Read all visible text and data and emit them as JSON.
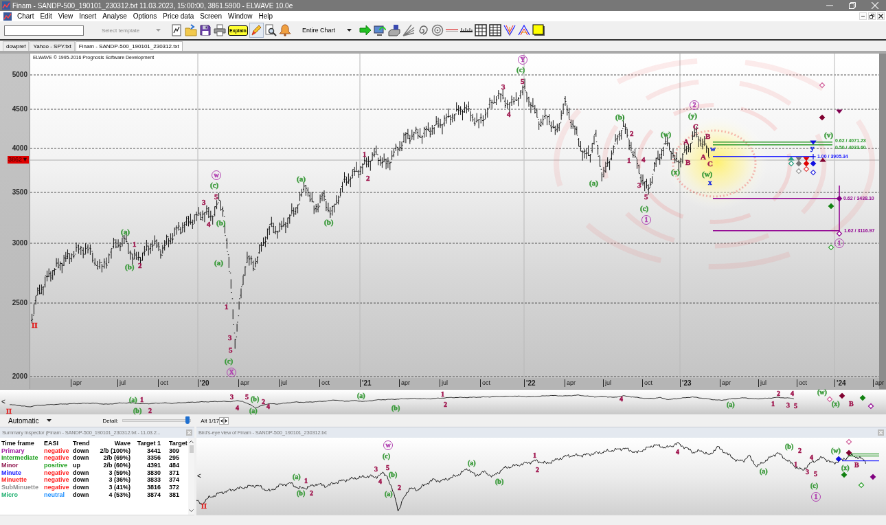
{
  "window": {
    "title": "Finam - SANDP-500_190101_230312.txt  11.03.2023, 15:00:00, 3861.5900 - ELWAVE 10.0e"
  },
  "menu": [
    "Chart",
    "Edit",
    "View",
    "Insert",
    "Analyse",
    "Options",
    "Price data",
    "Screen",
    "Window",
    "Help"
  ],
  "toolbar": {
    "template": {
      "placeholder": "Select template",
      "disabled": true
    },
    "tools_left": [
      {
        "kind": "chart",
        "selected": false
      },
      {
        "kind": "open",
        "selected": false
      },
      {
        "kind": "save",
        "selected": false
      },
      {
        "kind": "print",
        "selected": false
      },
      {
        "kind": "explain",
        "label": "Explain",
        "selected": false
      },
      {
        "kind": "draw",
        "selected": true
      },
      {
        "kind": "inspect",
        "selected": false
      },
      {
        "kind": "alert",
        "selected": false
      }
    ],
    "range": "Entire Chart",
    "tools_right": [
      {
        "kind": "go",
        "selected": false
      },
      {
        "kind": "monitor",
        "selected": false
      },
      {
        "kind": "drive",
        "selected": false
      },
      {
        "kind": "fan",
        "selected": false
      },
      {
        "kind": "spiral",
        "selected": false
      },
      {
        "kind": "circles",
        "selected": false
      },
      {
        "kind": "line",
        "selected": false
      },
      {
        "kind": "ruler",
        "selected": false
      },
      {
        "kind": "grid",
        "selected": false
      },
      {
        "kind": "table",
        "selected": false
      },
      {
        "kind": "vee",
        "selected": false
      },
      {
        "kind": "wedge",
        "selected": false
      },
      {
        "kind": "highlight",
        "selected": false
      }
    ]
  },
  "tabs": [
    {
      "label": "dowpref",
      "selected": false
    },
    {
      "label": "Yahoo - SPY.txt",
      "selected": false
    },
    {
      "label": "Finam - SANDP-500_190101_230312.txt",
      "selected": true
    }
  ],
  "chart": {
    "copyright": "ELWAVE © 1995-2016 Prognosis Software Development",
    "price_labels": [
      "5000",
      "4500",
      "4000",
      "3500",
      "3000",
      "2500",
      "2000"
    ],
    "current_price": "3862▼",
    "time_labels": [
      {
        "text": "apr",
        "kind": "month"
      },
      {
        "text": "jul",
        "kind": "month"
      },
      {
        "text": "oct",
        "kind": "month"
      },
      {
        "text": "'20",
        "kind": "year"
      },
      {
        "text": "apr",
        "kind": "month"
      },
      {
        "text": "jul",
        "kind": "month"
      },
      {
        "text": "oct",
        "kind": "month"
      },
      {
        "text": "'21",
        "kind": "year"
      },
      {
        "text": "apr",
        "kind": "month"
      },
      {
        "text": "jul",
        "kind": "month"
      },
      {
        "text": "oct",
        "kind": "month"
      },
      {
        "text": "'22",
        "kind": "year"
      },
      {
        "text": "apr",
        "kind": "month"
      },
      {
        "text": "jul",
        "kind": "month"
      },
      {
        "text": "oct",
        "kind": "month"
      },
      {
        "text": "'23",
        "kind": "year"
      },
      {
        "text": "apr",
        "kind": "month"
      },
      {
        "text": "jul",
        "kind": "month"
      },
      {
        "text": "oct",
        "kind": "month"
      },
      {
        "text": "'24",
        "kind": "year"
      },
      {
        "text": "apr",
        "kind": "month"
      }
    ],
    "wave_labels": [
      {
        "text": "II",
        "color": "#e02020",
        "kind": "plain"
      },
      {
        "text": "(a)",
        "color": "#3a9a3a",
        "kind": "plain"
      },
      {
        "text": "1",
        "color": "#a01850",
        "kind": "plain"
      },
      {
        "text": "(b)",
        "color": "#3a9a3a",
        "kind": "plain"
      },
      {
        "text": "2",
        "color": "#a01850",
        "kind": "plain"
      },
      {
        "text": "3",
        "color": "#a01850",
        "kind": "plain"
      },
      {
        "text": "4",
        "color": "#a01850",
        "kind": "plain"
      },
      {
        "text": "w",
        "color": "#b040b0",
        "kind": "circled"
      },
      {
        "text": "(c)",
        "color": "#3a9a3a",
        "kind": "plain"
      },
      {
        "text": "5",
        "color": "#a01850",
        "kind": "plain"
      },
      {
        "text": "(b)",
        "color": "#3a9a3a",
        "kind": "plain"
      },
      {
        "text": "(a)",
        "color": "#3a9a3a",
        "kind": "plain"
      },
      {
        "text": "1",
        "color": "#a01850",
        "kind": "plain"
      },
      {
        "text": "3",
        "color": "#a01850",
        "kind": "plain"
      },
      {
        "text": "5",
        "color": "#a01850",
        "kind": "plain"
      },
      {
        "text": "(c)",
        "color": "#3a9a3a",
        "kind": "plain"
      },
      {
        "text": "X",
        "color": "#b040b0",
        "kind": "circled"
      },
      {
        "text": "(a)",
        "color": "#3a9a3a",
        "kind": "plain"
      },
      {
        "text": "(b)",
        "color": "#3a9a3a",
        "kind": "plain"
      },
      {
        "text": "1",
        "color": "#a01850",
        "kind": "plain"
      },
      {
        "text": "2",
        "color": "#a01850",
        "kind": "plain"
      },
      {
        "text": "3",
        "color": "#a01850",
        "kind": "plain"
      },
      {
        "text": "4",
        "color": "#a01850",
        "kind": "plain"
      },
      {
        "text": "Y",
        "color": "#b040b0",
        "kind": "circled"
      },
      {
        "text": "(c)",
        "color": "#3a9a3a",
        "kind": "plain"
      },
      {
        "text": "5",
        "color": "#a01850",
        "kind": "plain"
      },
      {
        "text": "(a)",
        "color": "#3a9a3a",
        "kind": "plain"
      },
      {
        "text": "(b)",
        "color": "#3a9a3a",
        "kind": "plain"
      },
      {
        "text": "2",
        "color": "#a01850",
        "kind": "plain"
      },
      {
        "text": "1",
        "color": "#a01850",
        "kind": "plain"
      },
      {
        "text": "3",
        "color": "#a01850",
        "kind": "plain"
      },
      {
        "text": "4",
        "color": "#a01850",
        "kind": "plain"
      },
      {
        "text": "5",
        "color": "#a01850",
        "kind": "plain"
      },
      {
        "text": "(c)",
        "color": "#3a9a3a",
        "kind": "plain"
      },
      {
        "text": "1",
        "color": "#b040b0",
        "kind": "circled"
      },
      {
        "text": "(w)",
        "color": "#3a9a3a",
        "kind": "plain"
      },
      {
        "text": "(x)",
        "color": "#3a9a3a",
        "kind": "plain"
      },
      {
        "text": "A",
        "color": "#a01850",
        "kind": "plain"
      },
      {
        "text": "B",
        "color": "#a01850",
        "kind": "plain"
      },
      {
        "text": "2",
        "color": "#b040b0",
        "kind": "circled"
      },
      {
        "text": "(y)",
        "color": "#3a9a3a",
        "kind": "plain"
      },
      {
        "text": "C",
        "color": "#a01850",
        "kind": "plain"
      },
      {
        "text": "B",
        "color": "#a01850",
        "kind": "plain"
      },
      {
        "text": "w",
        "color": "#2030e0",
        "kind": "plain"
      },
      {
        "text": "A",
        "color": "#a01850",
        "kind": "plain"
      },
      {
        "text": "C",
        "color": "#a01850",
        "kind": "plain"
      },
      {
        "text": "(w)",
        "color": "#3a9a3a",
        "kind": "plain"
      },
      {
        "text": "x",
        "color": "#2030e0",
        "kind": "plain"
      },
      {
        "text": "y",
        "color": "#2030e0",
        "kind": "plain"
      },
      {
        "text": "(v)",
        "color": "#3a9a3a",
        "kind": "plain"
      },
      {
        "text": "1",
        "color": "#b040b0",
        "kind": "circled"
      }
    ],
    "target_levels": [
      {
        "label": "0.62 / 4071.23",
        "color": "#2a9a2a"
      },
      {
        "label": "0.50 / 4033.60",
        "color": "#2a9a2a"
      },
      {
        "label": "1.00 / 3905.34",
        "color": "#2020ff"
      },
      {
        "label": "0.62 / 3438.10",
        "color": "#900090"
      },
      {
        "label": "1.62 / 3116.97",
        "color": "#900090"
      }
    ]
  },
  "overview": {
    "scroll_left": "<",
    "wave_labels": [
      {
        "text": "(a)",
        "color": "#3a9a3a"
      },
      {
        "text": "1",
        "color": "#a01850"
      },
      {
        "text": "(b)",
        "color": "#3a9a3a"
      },
      {
        "text": "2",
        "color": "#a01850"
      },
      {
        "text": "3",
        "color": "#a01850"
      },
      {
        "text": "4",
        "color": "#a01850"
      },
      {
        "text": "5",
        "color": "#a01850"
      },
      {
        "text": "(b)",
        "color": "#3a9a3a"
      },
      {
        "text": "2",
        "color": "#a01850"
      },
      {
        "text": "4",
        "color": "#a01850"
      },
      {
        "text": "(a)",
        "color": "#3a9a3a"
      },
      {
        "text": "(a)",
        "color": "#3a9a3a"
      },
      {
        "text": "(b)",
        "color": "#3a9a3a"
      },
      {
        "text": "1",
        "color": "#a01850"
      },
      {
        "text": "2",
        "color": "#a01850"
      },
      {
        "text": "4",
        "color": "#a01850"
      },
      {
        "text": "(a)",
        "color": "#3a9a3a"
      },
      {
        "text": "2",
        "color": "#a01850"
      },
      {
        "text": "1",
        "color": "#a01850"
      },
      {
        "text": "3",
        "color": "#a01850"
      },
      {
        "text": "4",
        "color": "#a01850"
      },
      {
        "text": "5",
        "color": "#a01850"
      },
      {
        "text": "(w)",
        "color": "#3a9a3a"
      },
      {
        "text": "(x)",
        "color": "#3a9a3a"
      },
      {
        "text": "B",
        "color": "#a01850"
      },
      {
        "text": "II",
        "color": "#e02020"
      }
    ]
  },
  "controls": {
    "mode": "Automatic",
    "detail_label": "Detail:",
    "detail": {
      "level": 0.96
    },
    "alternative": "Alt 1/17"
  },
  "summary": {
    "title": "Summary Inspector (Finam - SANDP-500_190101_230312.txt - 11.03.2...",
    "columns": [
      "Time frame",
      "EASI",
      "Trend",
      "Wave",
      "Target 1",
      "Target"
    ],
    "rows": [
      {
        "time_frame": {
          "text": "Primary",
          "color": "#a020a0"
        },
        "easi": {
          "text": "negative",
          "color": "#ff2020"
        },
        "trend": "down",
        "wave": "2/b (100%)",
        "target_1": "3441",
        "column_6": "309"
      },
      {
        "time_frame": {
          "text": "Intermediate",
          "color": "#20a020"
        },
        "easi": {
          "text": "negative",
          "color": "#ff2020"
        },
        "trend": "down",
        "wave": "2/b (69%)",
        "target_1": "3356",
        "column_6": "295"
      },
      {
        "time_frame": {
          "text": "Minor",
          "color": "#901850"
        },
        "easi": {
          "text": "positive",
          "color": "#20a020"
        },
        "trend": "up",
        "wave": "2/b (60%)",
        "target_1": "4391",
        "column_6": "484"
      },
      {
        "time_frame": {
          "text": "Minute",
          "color": "#2020ff"
        },
        "easi": {
          "text": "negative",
          "color": "#ff2020"
        },
        "trend": "down",
        "wave": "3 (59%)",
        "target_1": "3830",
        "column_6": "371"
      },
      {
        "time_frame": {
          "text": "Minuette",
          "color": "#ff2020"
        },
        "easi": {
          "text": "negative",
          "color": "#ff2020"
        },
        "trend": "down",
        "wave": "3 (36%)",
        "target_1": "3833",
        "column_6": "374"
      },
      {
        "time_frame": {
          "text": "SubMinuette",
          "color": "#909090"
        },
        "easi": {
          "text": "negative",
          "color": "#ff2020"
        },
        "trend": "down",
        "wave": "3 (41%)",
        "target_1": "3816",
        "column_6": "372"
      },
      {
        "time_frame": {
          "text": "Micro",
          "color": "#20b070"
        },
        "easi": {
          "text": "neutral",
          "color": "#2090ff"
        },
        "trend": "down",
        "wave": "4 (53%)",
        "target_1": "3874",
        "column_6": "381"
      }
    ]
  },
  "birds_eye": {
    "title": "Bird's-eye view of Finam - SANDP-500_190101_230312.txt",
    "scroll_left": "<",
    "wave_labels": [
      {
        "text": "II",
        "color": "#e02020",
        "kind": "plain"
      },
      {
        "text": "(a)",
        "color": "#3a9a3a",
        "kind": "plain"
      },
      {
        "text": "1",
        "color": "#a01850",
        "kind": "plain"
      },
      {
        "text": "(b)",
        "color": "#3a9a3a",
        "kind": "plain"
      },
      {
        "text": "2",
        "color": "#a01850",
        "kind": "plain"
      },
      {
        "text": "w",
        "color": "#b040b0",
        "kind": "circled"
      },
      {
        "text": "(c)",
        "color": "#3a9a3a",
        "kind": "plain"
      },
      {
        "text": "3",
        "color": "#a01850",
        "kind": "plain"
      },
      {
        "text": "5",
        "color": "#a01850",
        "kind": "plain"
      },
      {
        "text": "4",
        "color": "#a01850",
        "kind": "plain"
      },
      {
        "text": "(b)",
        "color": "#3a9a3a",
        "kind": "plain"
      },
      {
        "text": "(a)",
        "color": "#3a9a3a",
        "kind": "plain"
      },
      {
        "text": "2",
        "color": "#a01850",
        "kind": "plain"
      },
      {
        "text": "(a)",
        "color": "#3a9a3a",
        "kind": "plain"
      },
      {
        "text": "(b)",
        "color": "#3a9a3a",
        "kind": "plain"
      },
      {
        "text": "1",
        "color": "#a01850",
        "kind": "plain"
      },
      {
        "text": "2",
        "color": "#a01850",
        "kind": "plain"
      },
      {
        "text": "4",
        "color": "#a01850",
        "kind": "plain"
      },
      {
        "text": "(b)",
        "color": "#3a9a3a",
        "kind": "plain"
      },
      {
        "text": "2",
        "color": "#a01850",
        "kind": "plain"
      },
      {
        "text": "4",
        "color": "#a01850",
        "kind": "plain"
      },
      {
        "text": "(a)",
        "color": "#3a9a3a",
        "kind": "plain"
      },
      {
        "text": "1",
        "color": "#a01850",
        "kind": "plain"
      },
      {
        "text": "3",
        "color": "#a01850",
        "kind": "plain"
      },
      {
        "text": "5",
        "color": "#a01850",
        "kind": "plain"
      },
      {
        "text": "(c)",
        "color": "#3a9a3a",
        "kind": "plain"
      },
      {
        "text": "1",
        "color": "#b040b0",
        "kind": "circled"
      },
      {
        "text": "(w)",
        "color": "#3a9a3a",
        "kind": "plain"
      },
      {
        "text": "(x)",
        "color": "#3a9a3a",
        "kind": "plain"
      },
      {
        "text": "B",
        "color": "#a01850",
        "kind": "plain"
      }
    ]
  }
}
